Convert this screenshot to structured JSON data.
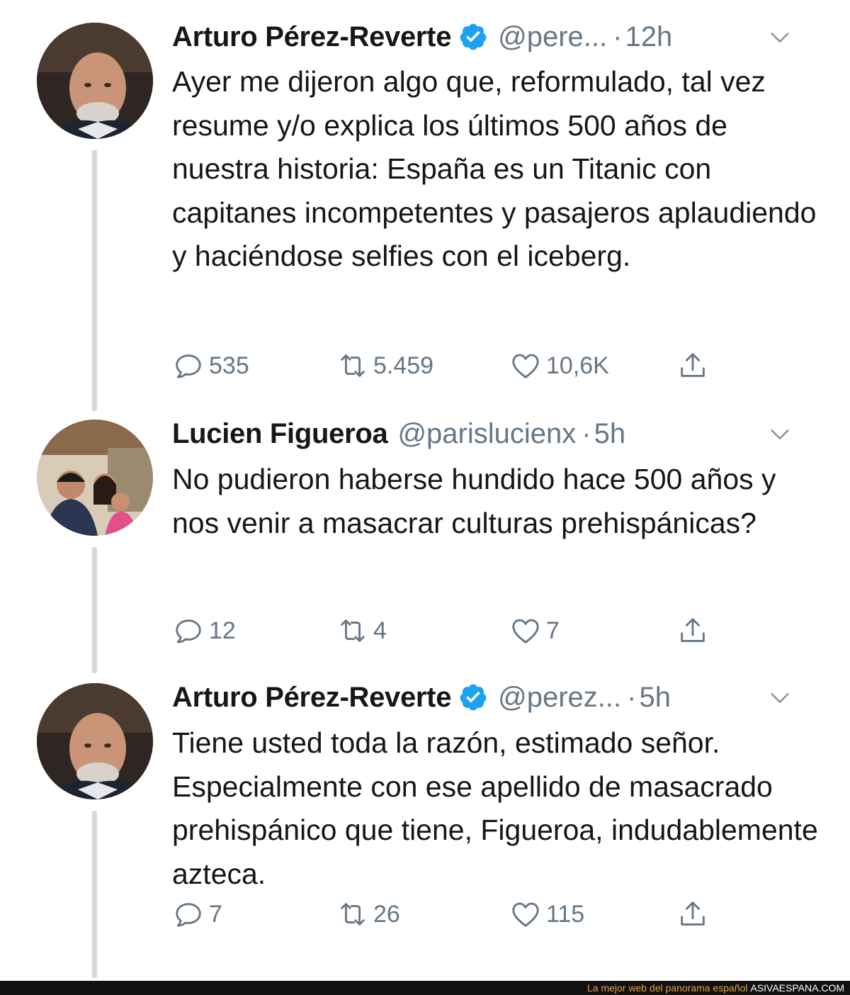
{
  "tweets": [
    {
      "name": "Arturo Pérez-Reverte",
      "verified": true,
      "handle": "@pere...",
      "separator": "·",
      "time": "12h",
      "text": "Ayer me dijeron algo que, reformulado, tal vez resume y/o explica los últimos 500 años de nuestra historia: España es un Titanic con capitanes incompetentes y pasajeros aplaudiendo y haciéndose selfies con el iceberg.",
      "replies": "535",
      "retweets": "5.459",
      "likes": "10,6K"
    },
    {
      "name": "Lucien Figueroa",
      "verified": false,
      "handle": "@parislucienx",
      "separator": "·",
      "time": "5h",
      "text": "No pudieron haberse hundido hace 500 años y nos venir a masacrar culturas prehispánicas?",
      "replies": "12",
      "retweets": "4",
      "likes": "7"
    },
    {
      "name": "Arturo Pérez-Reverte",
      "verified": true,
      "handle": "@perez...",
      "separator": "·",
      "time": "5h",
      "text": "Tiene usted toda la razón, estimado señor. Especialmente con ese apellido de masacrado prehispánico que tiene, Figueroa, indudablemente azteca.",
      "replies": "7",
      "retweets": "26",
      "likes": "115"
    }
  ],
  "icons": {
    "reply": "reply-icon",
    "retweet": "retweet-icon",
    "like": "heart-icon",
    "share": "share-icon",
    "menu": "chevron-down-icon",
    "verified": "verified-badge-icon"
  },
  "colors": {
    "text": "#14171a",
    "muted": "#657786",
    "verified": "#1da1f2",
    "thread": "#d3dbe1"
  },
  "footer": {
    "tagline": "La mejor web del panorama español",
    "site": "ASIVAESPANA.COM"
  }
}
